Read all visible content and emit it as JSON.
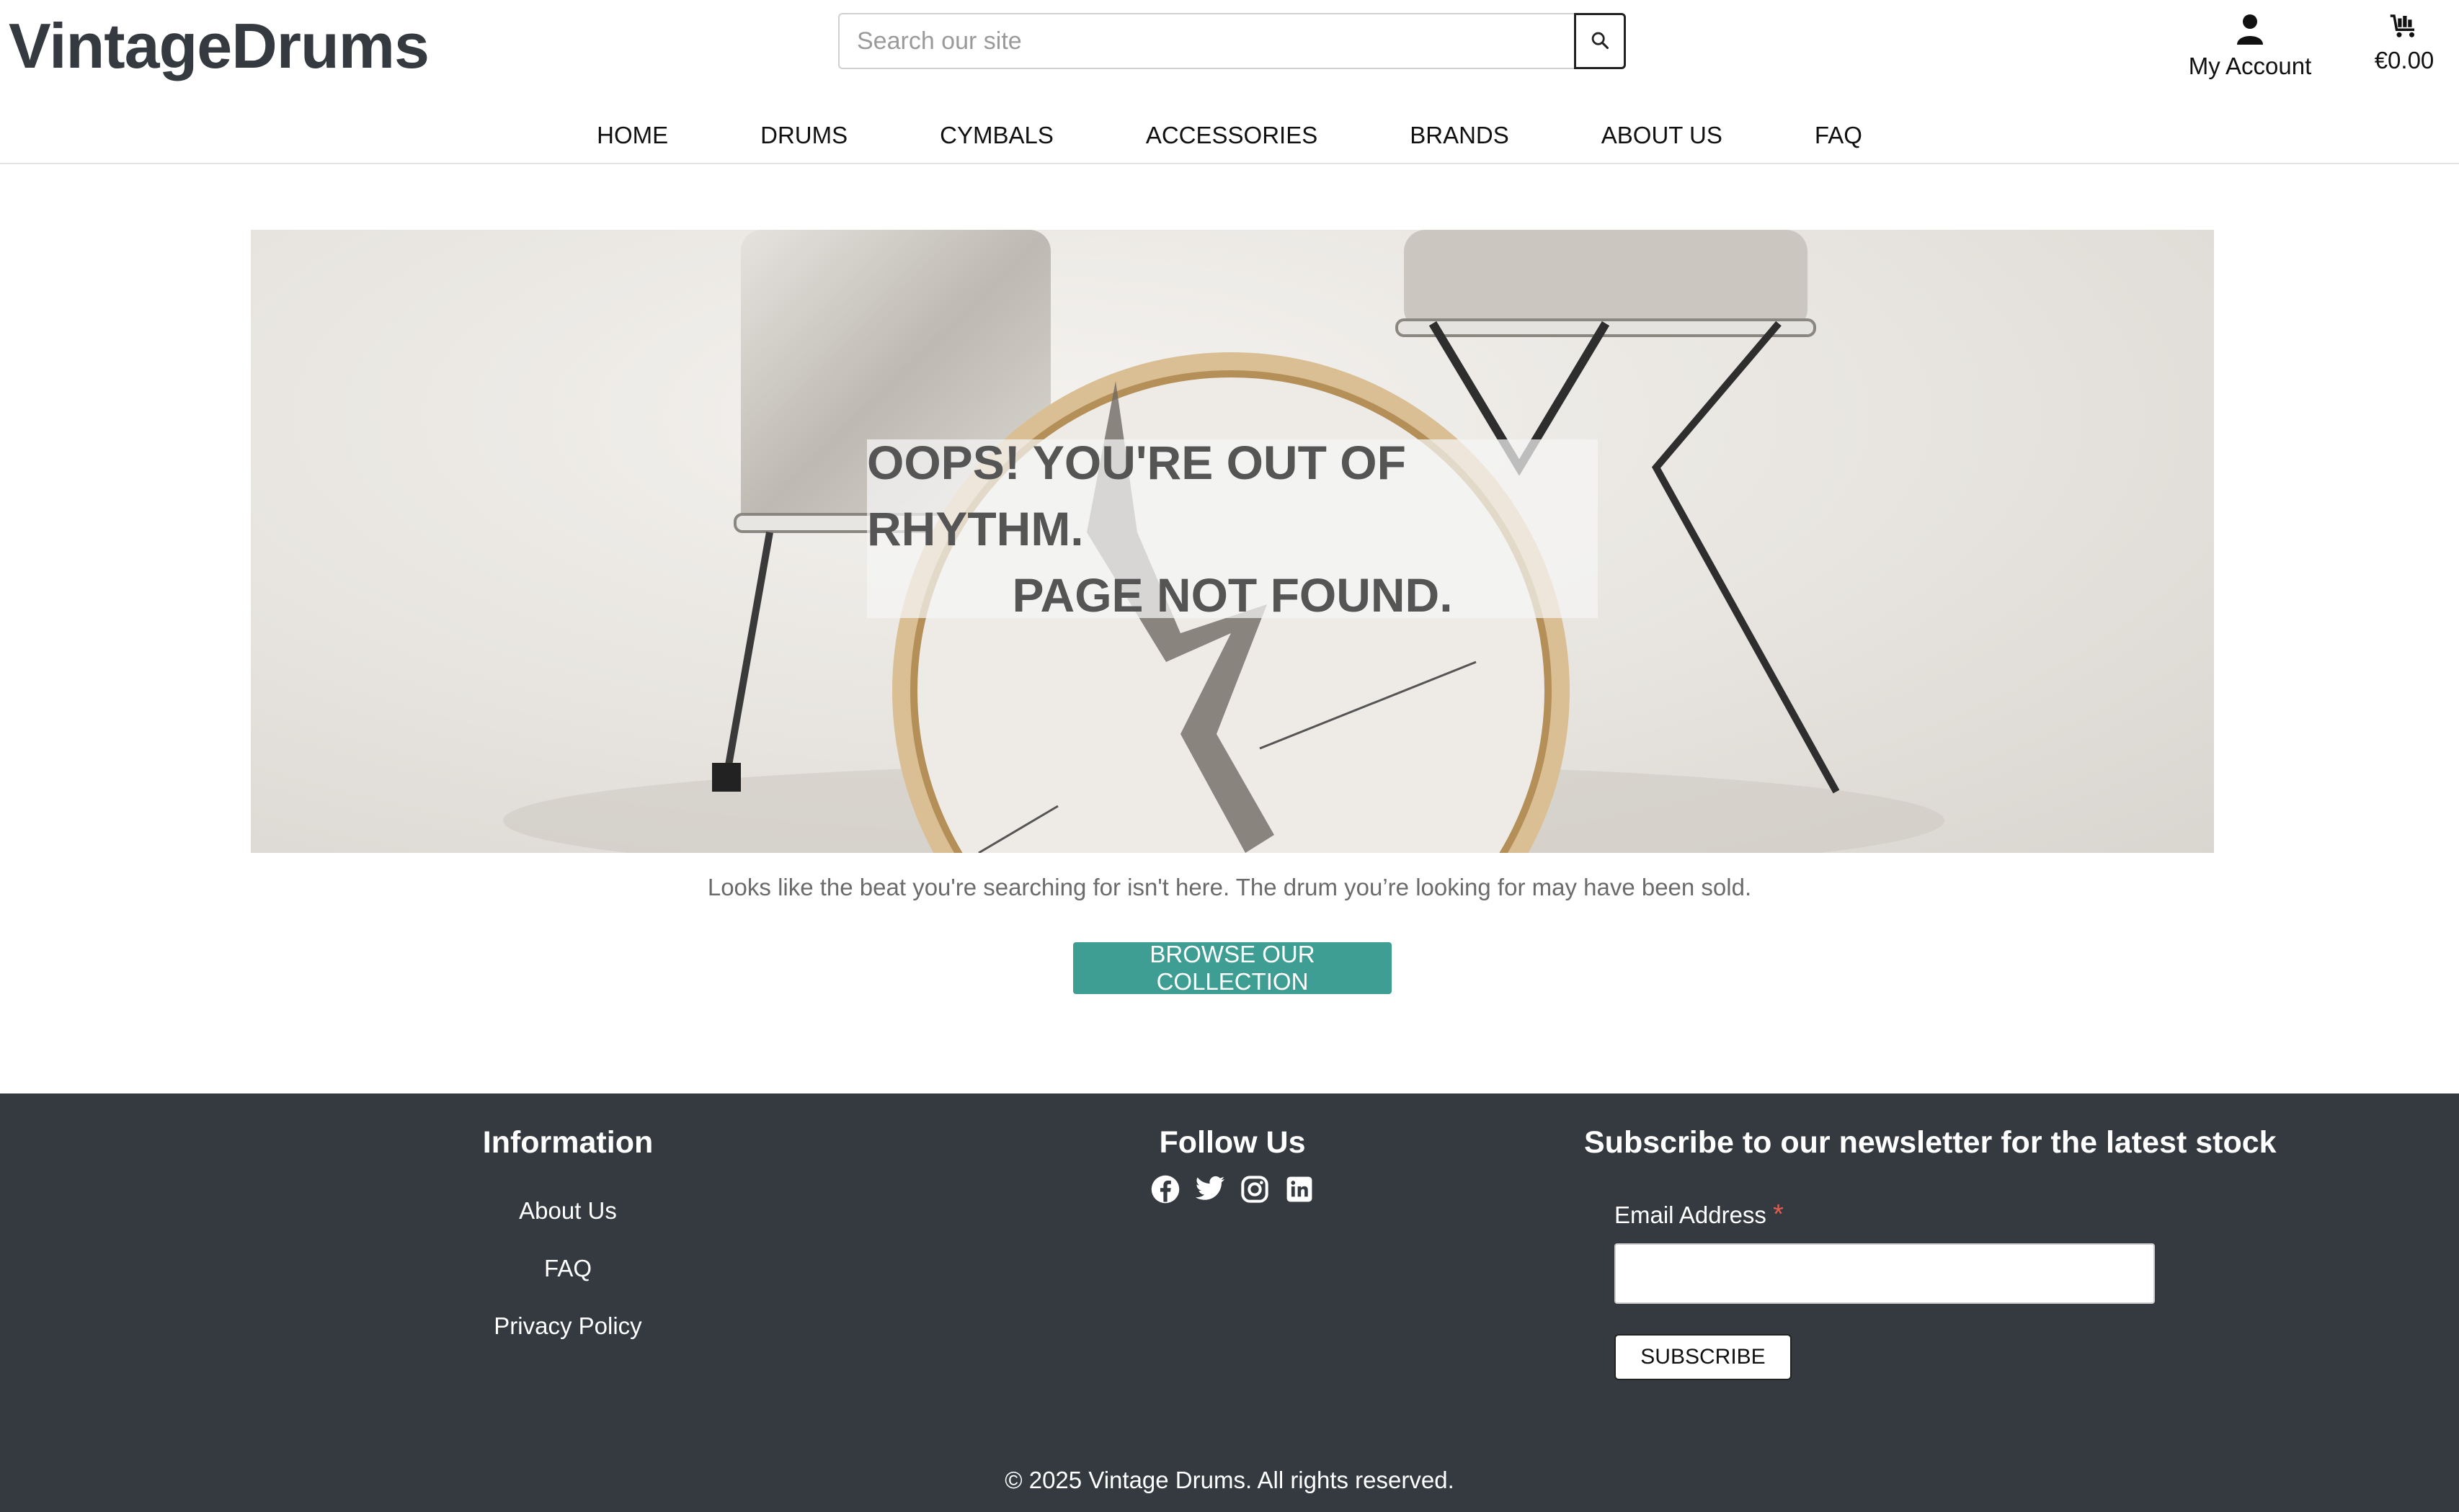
{
  "header": {
    "logo": "VintageDrums",
    "search_placeholder": "Search our site",
    "account_label": "My Account",
    "cart_total": "€0.00"
  },
  "nav": {
    "items": [
      "HOME",
      "DRUMS",
      "CYMBALS",
      "ACCESSORIES",
      "BRANDS",
      "ABOUT US",
      "FAQ"
    ]
  },
  "hero": {
    "line1": "OOPS! YOU'RE OUT OF RHYTHM.",
    "line2": "PAGE NOT FOUND."
  },
  "main": {
    "notice": "Looks like the beat you're searching for isn't here. The drum you’re looking for may have been sold.",
    "browse_button": "BROWSE OUR COLLECTION"
  },
  "footer": {
    "info_title": "Information",
    "info_links": [
      "About Us",
      "FAQ",
      "Privacy Policy"
    ],
    "follow_title": "Follow Us",
    "social_icons": [
      "facebook-icon",
      "twitter-icon",
      "instagram-icon",
      "linkedin-icon"
    ],
    "newsletter_title": "Subscribe to our newsletter for the latest stock",
    "email_label": "Email Address",
    "required_mark": "*",
    "subscribe_button": "SUBSCRIBE",
    "copyright": "© 2025 Vintage Drums. All rights reserved."
  },
  "colors": {
    "footer_bg": "#343a40",
    "accent": "#3f9e93",
    "required": "#e25d4f"
  }
}
